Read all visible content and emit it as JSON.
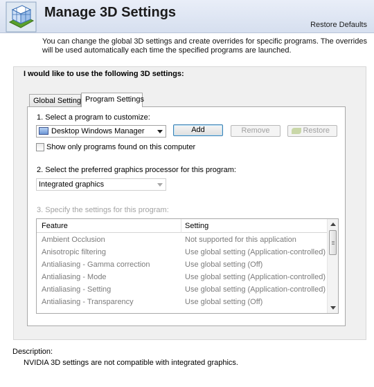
{
  "header": {
    "title": "Manage 3D Settings",
    "restore_defaults": "Restore Defaults",
    "logo_icon": "nvidia-3d-cube-icon"
  },
  "intro": "You can change the global 3D settings and create overrides for specific programs. The overrides will be used automatically each time the specified programs are launched.",
  "group_title": "I would like to use the following 3D settings:",
  "tabs": [
    {
      "label": "Global Settings",
      "selected": false
    },
    {
      "label": "Program Settings",
      "selected": true
    }
  ],
  "program_section": {
    "step1_label": "1. Select a program to customize:",
    "selected_program": "Desktop Windows Manager",
    "buttons": {
      "add": "Add",
      "remove": "Remove",
      "restore": "Restore"
    },
    "checkbox_label": "Show only programs found on this computer",
    "checkbox_checked": false,
    "step2_label": "2. Select the preferred graphics processor for this program:",
    "selected_gpu": "Integrated graphics",
    "step3_label": "3. Specify the settings for this program:"
  },
  "feature_list": {
    "columns": [
      "Feature",
      "Setting"
    ],
    "rows": [
      {
        "feature": "Ambient Occlusion",
        "setting": "Not supported for this application"
      },
      {
        "feature": "Anisotropic filtering",
        "setting": "Use global setting (Application-controlled)"
      },
      {
        "feature": "Antialiasing - Gamma correction",
        "setting": "Use global setting (Off)"
      },
      {
        "feature": "Antialiasing - Mode",
        "setting": "Use global setting (Application-controlled)"
      },
      {
        "feature": "Antialiasing - Setting",
        "setting": "Use global setting (Application-controlled)"
      },
      {
        "feature": "Antialiasing - Transparency",
        "setting": "Use global setting (Off)"
      }
    ]
  },
  "description": {
    "label": "Description:",
    "text": "NVIDIA 3D settings are not compatible with integrated graphics."
  }
}
